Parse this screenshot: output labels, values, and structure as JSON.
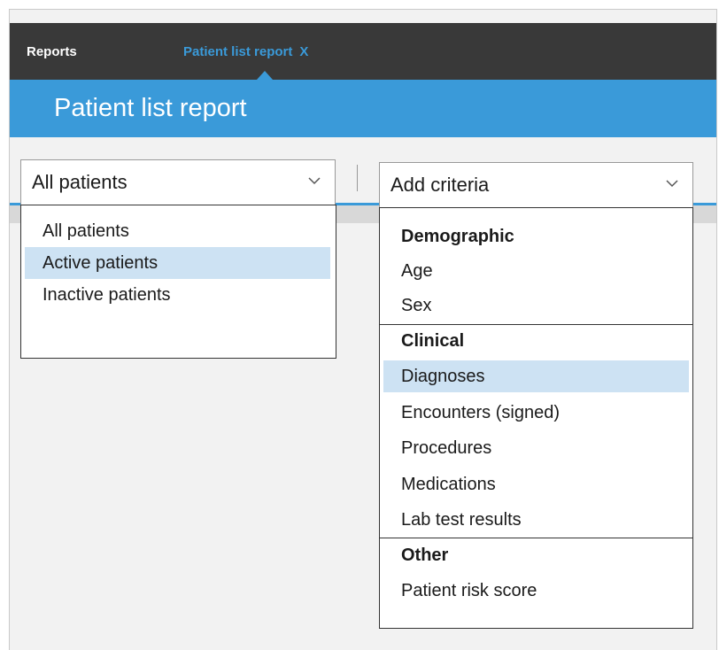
{
  "tabs": {
    "reports_label": "Reports",
    "patient_list_label": "Patient list report",
    "close_label": "X"
  },
  "header": {
    "title": "Patient list report"
  },
  "patient_filter": {
    "selected_value": "All patients",
    "options": [
      "All patients",
      "Active patients",
      "Inactive patients"
    ],
    "highlighted": "Active patients"
  },
  "criteria": {
    "placeholder": "Add criteria",
    "groups": [
      {
        "label": "Demographic",
        "items": [
          "Age",
          "Sex"
        ]
      },
      {
        "label": "Clinical",
        "items": [
          "Diagnoses",
          "Encounters (signed)",
          "Procedures",
          "Medications",
          "Lab test results"
        ]
      },
      {
        "label": "Other",
        "items": [
          "Patient risk score"
        ]
      }
    ],
    "highlighted": "Diagnoses"
  },
  "colors": {
    "tab_bar": "#393939",
    "accent_blue": "#3a9ad9",
    "highlight": "#cde2f3"
  },
  "icons": [
    "chevron-down-icon",
    "close-icon"
  ]
}
